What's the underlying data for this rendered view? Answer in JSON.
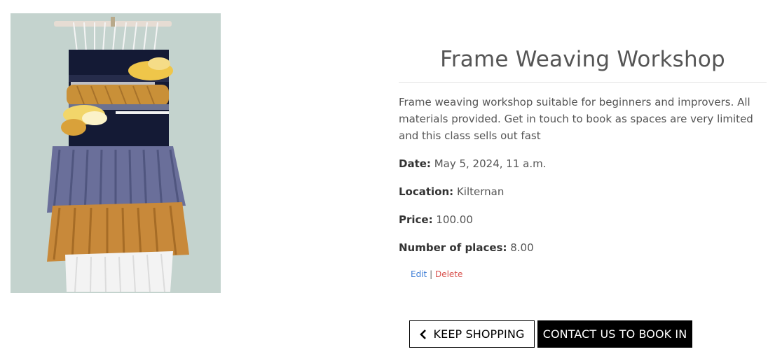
{
  "product": {
    "image_alt": "Frame woven wall hanging with navy, mustard, lavender and white fringes",
    "name": "Frame Weaving Workshop",
    "description": "Frame weaving workshop suitable for beginners and improvers. All materials provided. Get in touch to book as spaces are very limited and this class sells out fast",
    "date_label": "Date:",
    "date_value": "May 5, 2024, 11 a.m.",
    "location_label": "Location:",
    "location_value": "Kilternan",
    "price_label": "Price:",
    "price_value": "100.00",
    "places_label": "Number of places:",
    "places_value": "8.00"
  },
  "admin": {
    "edit_label": "Edit",
    "separator": "|",
    "delete_label": "Delete"
  },
  "actions": {
    "keep_shopping_label": "KEEP SHOPPING",
    "keep_shopping_icon": "chevron-left-icon",
    "contact_label": "CONTACT US TO BOOK IN"
  },
  "colors": {
    "edit_link": "#3a7bd5",
    "delete_link": "#d9534f",
    "primary_button_bg": "#000000"
  }
}
